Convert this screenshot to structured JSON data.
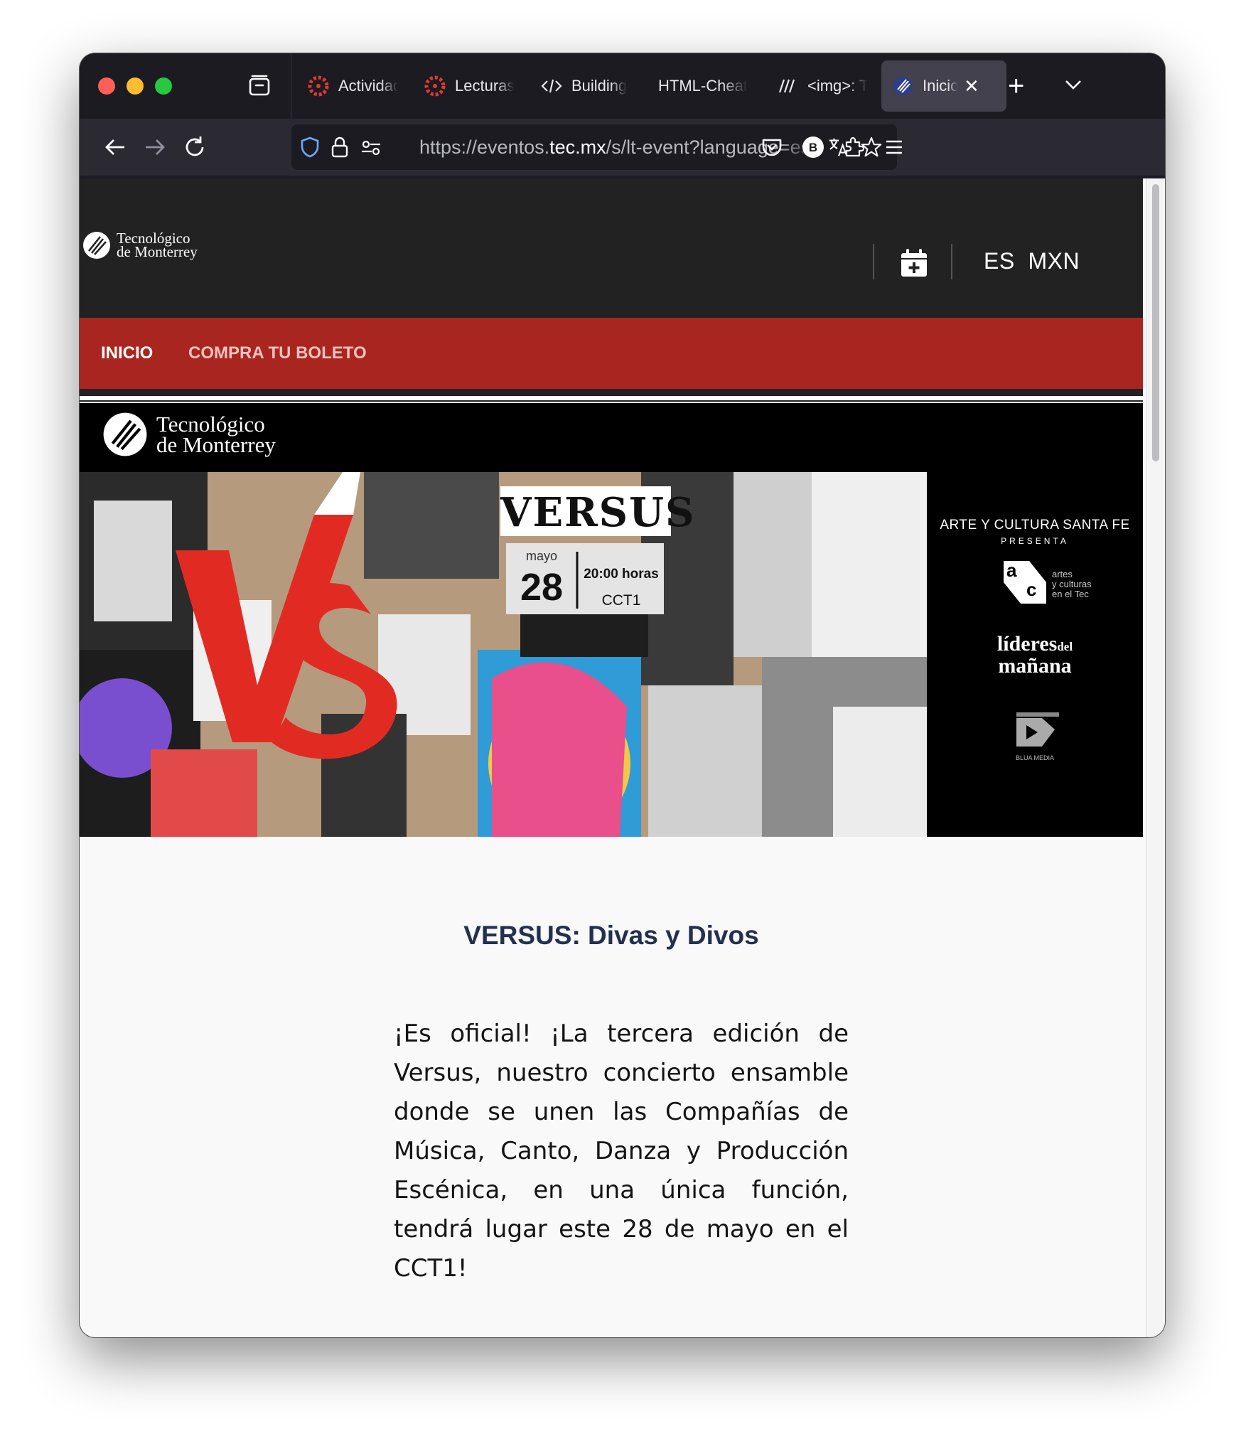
{
  "browser": {
    "tabs": [
      {
        "label": "Actividad",
        "icon": "canvas-icon",
        "active": false
      },
      {
        "label": "Lecturas",
        "icon": "canvas-icon",
        "active": false
      },
      {
        "label": "Building",
        "icon": "code-icon",
        "active": false
      },
      {
        "label": "HTML-Cheat",
        "icon": "none",
        "active": false
      },
      {
        "label": "<img>: T",
        "icon": "mdn-icon",
        "active": false
      },
      {
        "label": "Inicio",
        "icon": "tec-icon",
        "active": true
      }
    ],
    "url_host_prefix": "https://eventos.",
    "url_host_main": "tec.mx",
    "url_path": "/s/lt-event?language=es"
  },
  "site": {
    "logo_line1": "Tecnológico",
    "logo_line2": "de Monterrey",
    "lang": "ES",
    "currency": "MXN",
    "nav": {
      "inicio": "INICIO",
      "compra": "COMPRA TU BOLETO"
    }
  },
  "banner": {
    "logo_line1": "Tecnológico",
    "logo_line2": "de Monterrey",
    "poster_title": "VERSUS",
    "month": "mayo",
    "day": "28",
    "time": "20:00 horas",
    "venue": "CCT1",
    "vs_mark": "VS",
    "presenter": "ARTE Y CULTURA SANTA FE",
    "presenta": "PRESENTA",
    "ac_a": "a",
    "ac_c": "c",
    "ac_text1": "artes",
    "ac_text2": "y culturas",
    "ac_text3": "en el Tec",
    "lideres1": "líderes",
    "lideres_del": "del",
    "lideres2": "mañana",
    "blua": "BLUA MEDIA"
  },
  "event": {
    "title": "VERSUS: Divas y Divos",
    "description": "¡Es oficial! ¡La tercera edición de Versus, nuestro concierto ensamble donde se unen las Compañías de Música, Canto, Danza y Producción Escénica, en una única función, tendrá lugar este 28 de mayo en el CCT1!"
  },
  "colors": {
    "header_bg": "#222222",
    "nav_red": "#a8261f",
    "title_navy": "#23304e"
  }
}
